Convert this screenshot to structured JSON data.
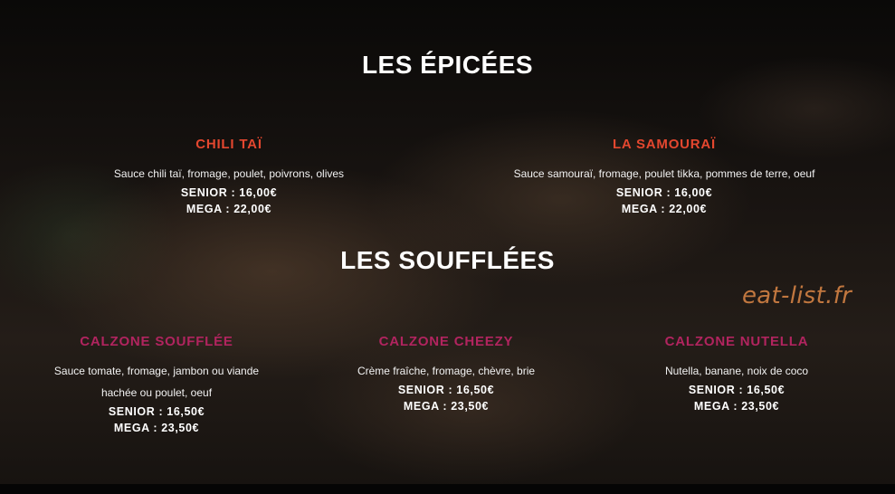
{
  "sections": [
    {
      "title": "LES ÉPICÉES",
      "items": [
        {
          "name": "CHILI TAÏ",
          "desc": "Sauce chili taï, fromage, poulet, poivrons, olives",
          "senior": "SENIOR : 16,00€",
          "mega": "MEGA : 22,00€"
        },
        {
          "name": "LA SAMOURAÏ",
          "desc": "Sauce samouraï, fromage, poulet tikka, pommes de terre, oeuf",
          "senior": "SENIOR : 16,00€",
          "mega": "MEGA : 22,00€"
        }
      ]
    },
    {
      "title": "LES SOUFFLÉES",
      "items": [
        {
          "name": "CALZONE SOUFFLÉE",
          "desc_line1": "Sauce tomate, fromage, jambon ou viande",
          "desc_line2": "hachée ou poulet, oeuf",
          "senior": "SENIOR : 16,50€",
          "mega": "MEGA : 23,50€"
        },
        {
          "name": "CALZONE CHEEZY",
          "desc": "Crème fraîche, fromage, chèvre, brie",
          "senior": "SENIOR : 16,50€",
          "mega": "MEGA : 23,50€"
        },
        {
          "name": "CALZONE NUTELLA",
          "desc": "Nutella, banane, noix de coco",
          "senior": "SENIOR : 16,50€",
          "mega": "MEGA : 23,50€"
        }
      ]
    }
  ],
  "watermark": "eat-list.fr",
  "colors": {
    "spicy_accent": "#e4472f",
    "souffle_accent": "#b1245f",
    "watermark": "#c1773f"
  }
}
